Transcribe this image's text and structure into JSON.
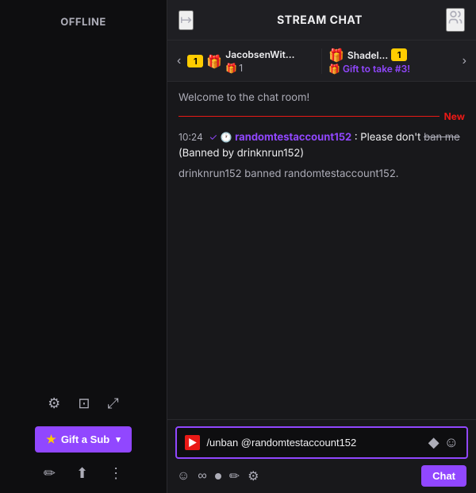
{
  "left": {
    "offline_label": "OFFLINE",
    "icons": {
      "settings": "⚙",
      "layout": "⊞",
      "expand": "⤢"
    },
    "gift_sub": {
      "label": "Gift a Sub",
      "chevron": "▾"
    },
    "bottom": {
      "pencil": "✏",
      "upload": "⬆",
      "more": "⋮"
    }
  },
  "chat": {
    "header": {
      "back_icon": "↦",
      "title": "STREAM CHAT",
      "user_icon": "👥"
    },
    "gift_bar": {
      "prev": "‹",
      "next": "›",
      "item1": {
        "badge": "1",
        "username": "JacobsenWit...",
        "gift_icon": "🎁",
        "count": "1"
      },
      "item2": {
        "username": "Shadel...",
        "gift_icon": "🎁",
        "badge": "1",
        "take_label": "Gift to take #3!"
      }
    },
    "messages": {
      "welcome": "Welcome to the chat room!",
      "new_label": "New",
      "msg1": {
        "time": "10:24",
        "check": "✓",
        "username": "randomtestaccount152",
        "text": ": Please don't ban me",
        "strikethrough": "ban me",
        "banned_by": "(Banned by drinknrun152)"
      },
      "system": "drinknrun152 banned randomtestaccount152."
    },
    "input": {
      "placeholder": "/unban @randomtestaccount152",
      "bookmark_icon": "◆",
      "emoji_icon": "☺"
    },
    "footer": {
      "chat_label": "Chat",
      "icons": {
        "face": "☺",
        "infinite": "∞",
        "pencil": "✏",
        "settings": "⚙"
      }
    }
  }
}
